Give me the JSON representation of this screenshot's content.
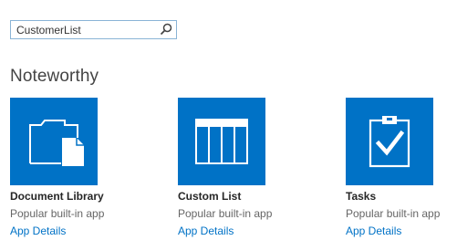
{
  "search": {
    "value": "CustomerList",
    "icon": "search-icon"
  },
  "section": {
    "title": "Noteworthy"
  },
  "tiles": [
    {
      "name": "Document Library",
      "description": "Popular built-in app",
      "link_label": "App Details",
      "icon": "document-library-icon"
    },
    {
      "name": "Custom List",
      "description": "Popular built-in app",
      "link_label": "App Details",
      "icon": "custom-list-icon"
    },
    {
      "name": "Tasks",
      "description": "Popular built-in app",
      "link_label": "App Details",
      "icon": "tasks-icon"
    }
  ],
  "colors": {
    "tile_background": "#0072c6",
    "link": "#0072c6",
    "search_border": "#8ab4d6"
  }
}
